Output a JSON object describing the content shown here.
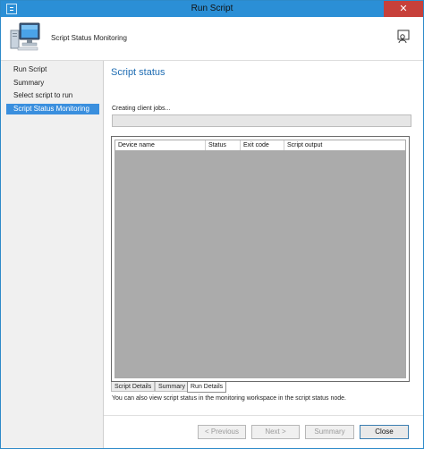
{
  "window": {
    "title": "Run Script",
    "close_glyph": "✕"
  },
  "header": {
    "title": "Script Status Monitoring",
    "icon": "computer-icon",
    "feedback_icon": "feedback-icon"
  },
  "sidebar": {
    "items": [
      {
        "label": "Run Script",
        "active": false
      },
      {
        "label": "Summary",
        "active": false
      },
      {
        "label": "Select script to run",
        "active": false
      },
      {
        "label": "Script Status Monitoring",
        "active": true
      }
    ]
  },
  "main": {
    "section_title": "Script status",
    "progress_label": "Creating client jobs...",
    "progress_fraction": 0,
    "columns": [
      "Device name",
      "Status",
      "Exit code",
      "Script output"
    ],
    "tabs": [
      "Script Details",
      "Summary",
      "Run Details"
    ],
    "active_tab": "Run Details",
    "info_text": "You can also view script status in the monitoring workspace in the script status node."
  },
  "buttons": {
    "previous": "< Previous",
    "next": "Next >",
    "summary": "Summary",
    "close": "Close"
  },
  "colors": {
    "titlebar": "#2b8fd6",
    "accent": "#3a8fde",
    "section_title": "#1f6db3",
    "grid_body": "#ababab"
  }
}
